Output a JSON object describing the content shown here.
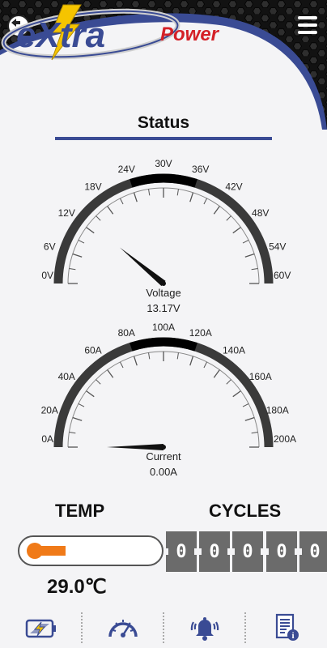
{
  "header": {
    "logo_text_main": "eXtra",
    "logo_text_accent": "Power",
    "back_icon": "back-arrow-icon",
    "menu_icon": "hamburger-menu-icon"
  },
  "status": {
    "title": "Status"
  },
  "voltage_gauge": {
    "name": "Voltage",
    "value_text": "13.17V",
    "value": 13.17,
    "min": 0,
    "max": 60,
    "tick_labels": [
      "0V",
      "6V",
      "12V",
      "18V",
      "24V",
      "30V",
      "36V",
      "42V",
      "48V",
      "54V",
      "60V"
    ],
    "highlight_range": [
      24,
      36
    ]
  },
  "current_gauge": {
    "name": "Current",
    "value_text": "0.00A",
    "value": 0,
    "min": 0,
    "max": 200,
    "tick_labels": [
      "0A",
      "20A",
      "40A",
      "60A",
      "80A",
      "100A",
      "120A",
      "140A",
      "160A",
      "180A",
      "200A"
    ],
    "highlight_range": [
      80,
      120
    ]
  },
  "temperature": {
    "label": "TEMP",
    "value_text": "29.0℃",
    "fill_fraction": 0.25
  },
  "cycles": {
    "label": "CYCLES",
    "digits": [
      "0",
      "0",
      "0",
      "0",
      "0"
    ]
  },
  "nav": {
    "items": [
      {
        "icon": "battery-icon"
      },
      {
        "icon": "speedometer-icon"
      },
      {
        "icon": "alarm-bell-icon"
      },
      {
        "icon": "info-document-icon"
      }
    ]
  },
  "colors": {
    "accent_blue": "#3a4b94",
    "temp_orange": "#f07a18",
    "logo_red": "#d42027",
    "logo_yellow": "#f5c400"
  }
}
